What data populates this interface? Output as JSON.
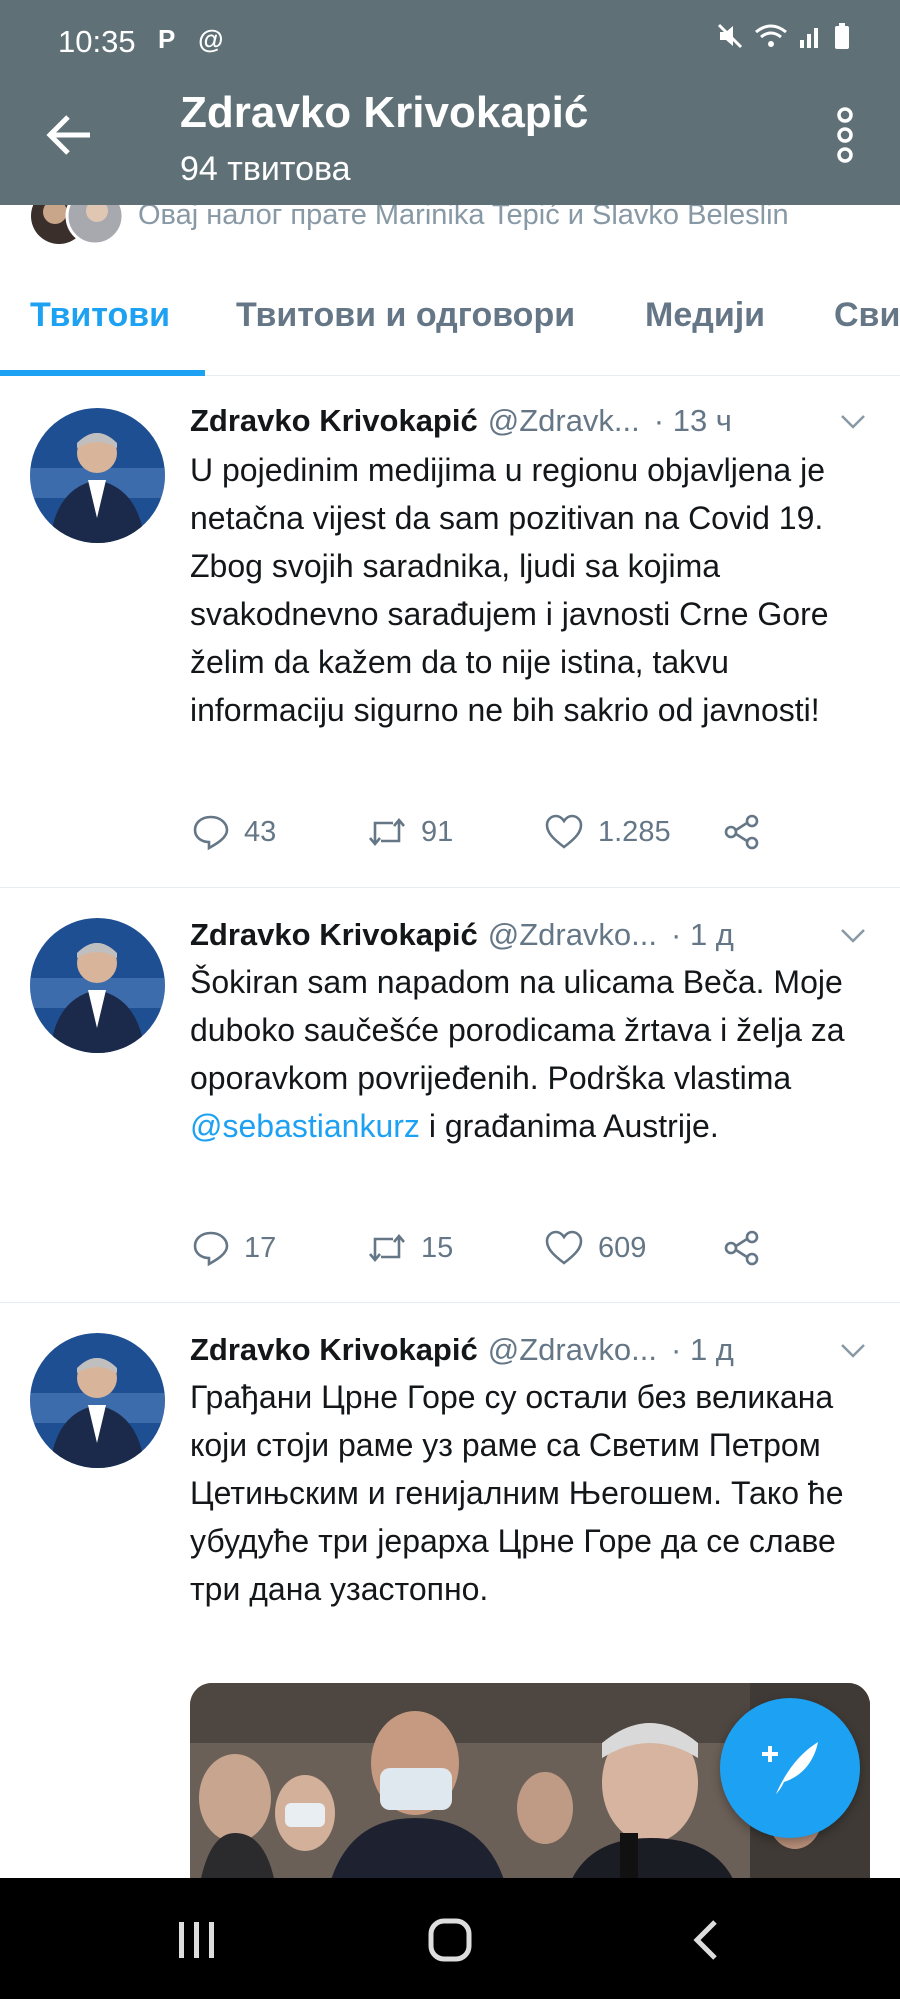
{
  "status_bar": {
    "time": "10:35",
    "left_icons": "P @",
    "right_icons": [
      "mute-icon",
      "wifi-icon",
      "signal-icon",
      "battery-icon"
    ]
  },
  "header": {
    "name": "Zdravko Krivokapić",
    "tweet_count": "94 твитова"
  },
  "followed_by": {
    "text": "Овај налог прате Marinika Tepić и Slavko Beleslin"
  },
  "tabs": [
    {
      "label": "Твитови",
      "active": true
    },
    {
      "label": "Твитови и одговори",
      "active": false
    },
    {
      "label": "Медији",
      "active": false
    },
    {
      "label": "Сви",
      "active": false
    }
  ],
  "tweets": [
    {
      "name": "Zdravko Krivokapić",
      "handle": "@Zdravk...",
      "time": "· 13 ч",
      "text": "U pojedinim medijima u regionu objavljena je netačna vijest da sam pozitivan na Covid 19. Zbog svojih saradnika, ljudi sa kojima svakodnevno sarađujem i javnosti Crne Gore želim da kažem da to nije istina, takvu informaciju sigurno ne bih sakrio od javnosti!",
      "replies": "43",
      "retweets": "91",
      "likes": "1.285"
    },
    {
      "name": "Zdravko Krivokapić",
      "handle": "@Zdravko...",
      "time": "· 1 д",
      "text_before": "Šokiran sam napadom na ulicama Beča. Moje duboko saučešće porodicama žrtava i želja za oporavkom povrijeđenih. Podrška vlastima ",
      "mention": "@sebastiankurz",
      "text_after": " i građanima Austrije.",
      "replies": "17",
      "retweets": "15",
      "likes": "609"
    },
    {
      "name": "Zdravko Krivokapić",
      "handle": "@Zdravko...",
      "time": "· 1 д",
      "text": "Грађани Црне Горе су остали без великана који стоји раме уз раме са Светим Петром Цетињским и генијалним Његошем. Тако ће убудуће три јерарха Црне Горе да се славе три дана узастопно."
    }
  ],
  "colors": {
    "header_bg": "#5f7177",
    "accent": "#1da1f2",
    "text": "#14171a",
    "muted": "#657786"
  },
  "icons": {
    "back": "arrow-left-icon",
    "menu": "more-vertical-icon",
    "reply": "comment-icon",
    "retweet": "retweet-icon",
    "like": "heart-icon",
    "share": "share-icon",
    "compose": "compose-tweet-icon"
  }
}
